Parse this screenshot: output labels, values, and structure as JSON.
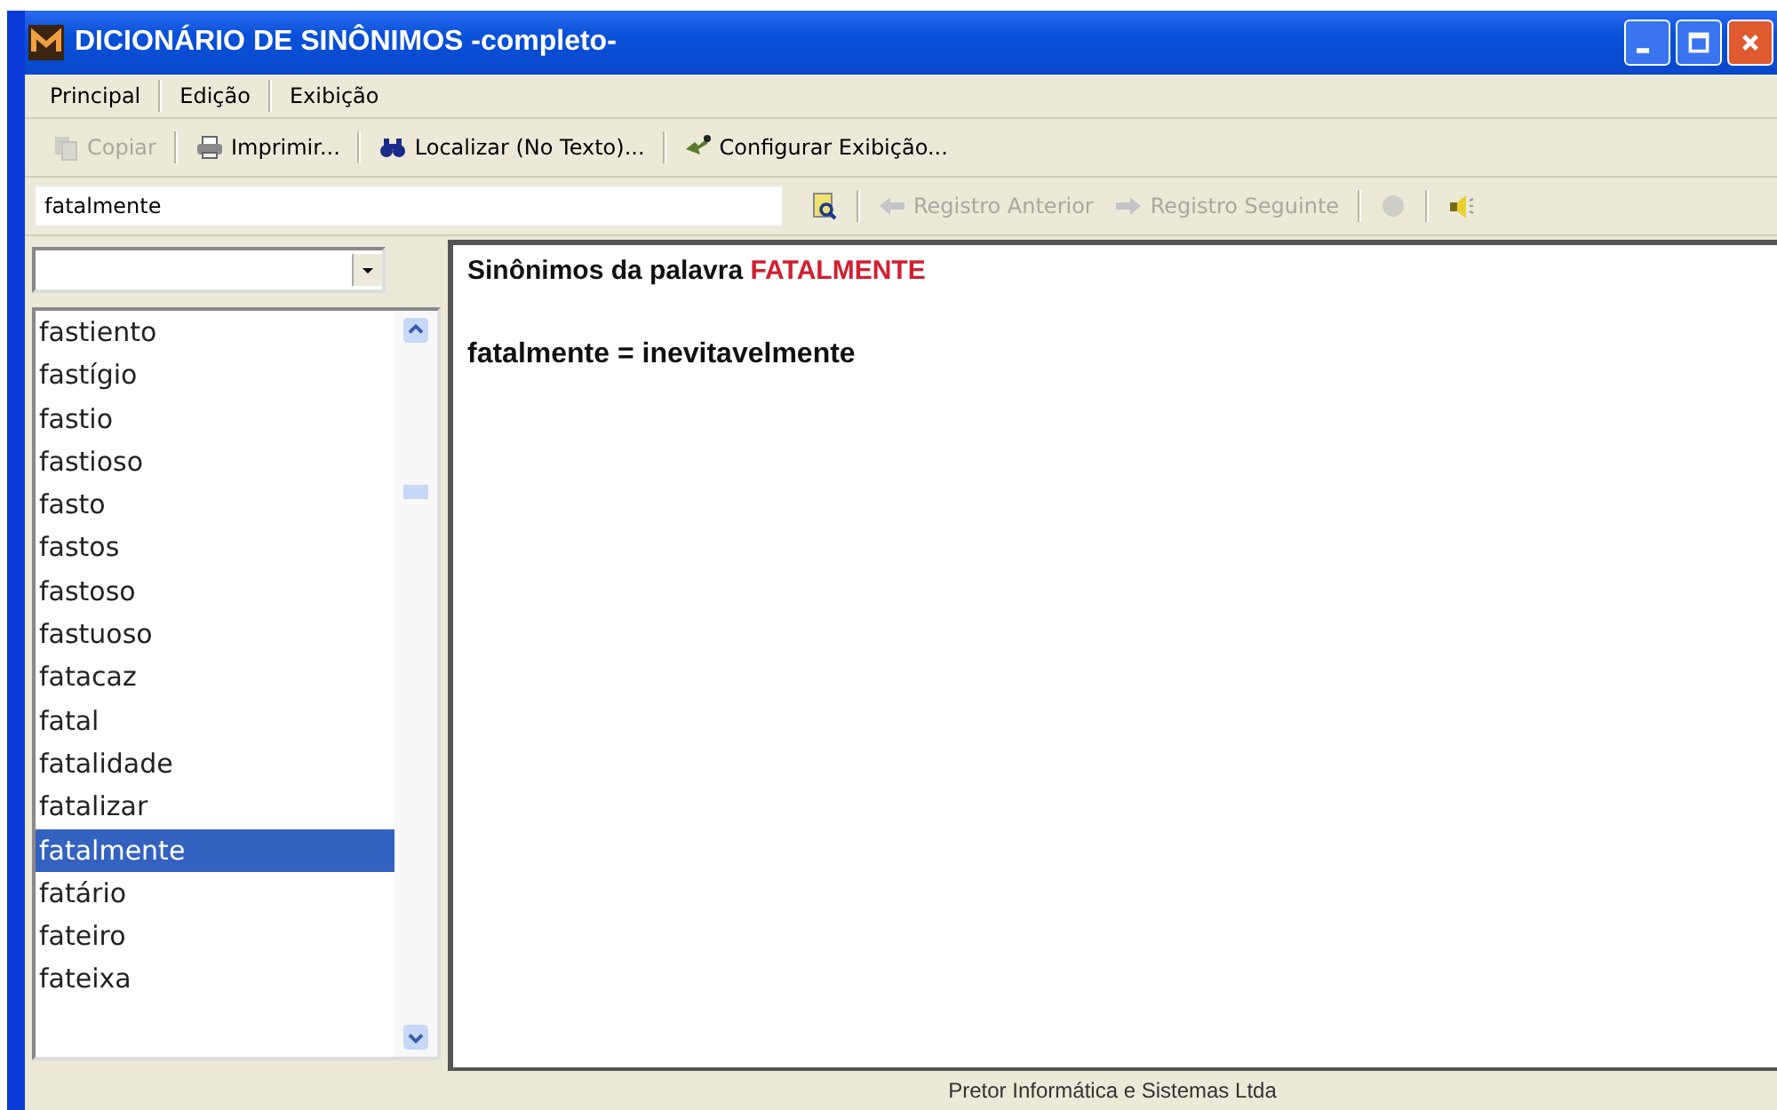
{
  "window": {
    "title": "DICIONÁRIO DE SINÔNIMOS -completo-"
  },
  "menu": [
    "Principal",
    "Edição",
    "Exibição"
  ],
  "toolbar": [
    {
      "label": "Copiar",
      "kind": "copy",
      "disabled": true
    },
    {
      "label": "Imprimir...",
      "kind": "print",
      "disabled": false
    },
    {
      "label": "Localizar (No Texto)...",
      "kind": "find",
      "disabled": false
    },
    {
      "label": "Configurar Exibição...",
      "kind": "config",
      "disabled": false
    }
  ],
  "navbar": {
    "search_value": "fatalmente",
    "buttons": [
      {
        "label": "Registro Anterior",
        "kind": "prev",
        "disabled": true
      },
      {
        "label": "Registro Seguinte",
        "kind": "next",
        "disabled": true
      },
      {
        "kind": "stop",
        "disabled": true
      },
      {
        "kind": "speaker",
        "disabled": false
      }
    ]
  },
  "word_list": [
    {
      "word": "fastiento",
      "selected": false
    },
    {
      "word": "fastígio",
      "selected": false
    },
    {
      "word": "fastio",
      "selected": false
    },
    {
      "word": "fastioso",
      "selected": false
    },
    {
      "word": "fasto",
      "selected": false
    },
    {
      "word": "fastos",
      "selected": false
    },
    {
      "word": "fastoso",
      "selected": false
    },
    {
      "word": "fastuoso",
      "selected": false
    },
    {
      "word": "fatacaz",
      "selected": false
    },
    {
      "word": "fatal",
      "selected": false
    },
    {
      "word": "fatalidade",
      "selected": false
    },
    {
      "word": "fatalizar",
      "selected": false
    },
    {
      "word": "fatalmente",
      "selected": true
    },
    {
      "word": "fatário",
      "selected": false
    },
    {
      "word": "fateiro",
      "selected": false
    },
    {
      "word": "fateixa",
      "selected": false
    }
  ],
  "content": {
    "heading": "Sinônimos da palavra",
    "heading_word": "FATALMENTE",
    "lines": [
      "fatalmente = inevitavelmente"
    ]
  },
  "status_bar": "Pretor Informática e Sistemas Ltda"
}
